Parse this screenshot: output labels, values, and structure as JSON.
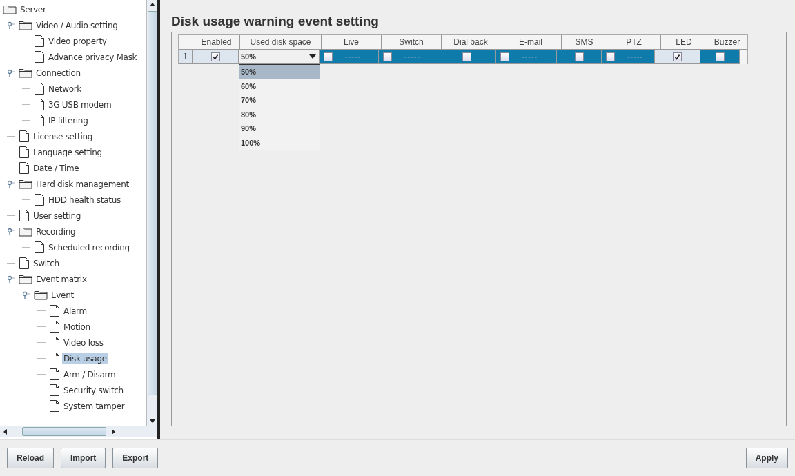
{
  "tree": [
    {
      "label": "Server",
      "selected": false,
      "children": [
        {
          "label": "Video / Audio setting",
          "expanded": true,
          "selected": false,
          "children": [
            {
              "label": "Video property",
              "selected": false
            },
            {
              "label": "Advance privacy Mask",
              "selected": false
            }
          ]
        },
        {
          "label": "Connection",
          "expanded": true,
          "selected": false,
          "children": [
            {
              "label": "Network",
              "selected": false
            },
            {
              "label": "3G USB modem",
              "selected": false
            },
            {
              "label": "IP filtering",
              "selected": false
            }
          ]
        },
        {
          "label": "License setting",
          "selected": false
        },
        {
          "label": "Language setting",
          "selected": false
        },
        {
          "label": "Date / Time",
          "selected": false
        },
        {
          "label": "Hard disk management",
          "expanded": true,
          "selected": false,
          "children": [
            {
              "label": "HDD health status",
              "selected": false
            }
          ]
        },
        {
          "label": "User setting",
          "selected": false
        },
        {
          "label": "Recording",
          "expanded": true,
          "selected": false,
          "children": [
            {
              "label": "Scheduled recording",
              "selected": false
            }
          ]
        },
        {
          "label": "Switch",
          "selected": false
        },
        {
          "label": "Event matrix",
          "expanded": true,
          "selected": false,
          "children": [
            {
              "label": "Event",
              "expanded": true,
              "selected": false,
              "children": [
                {
                  "label": "Alarm",
                  "selected": false
                },
                {
                  "label": "Motion",
                  "selected": false
                },
                {
                  "label": "Video loss",
                  "selected": false
                },
                {
                  "label": "Disk usage",
                  "selected": true
                },
                {
                  "label": "Arm / Disarm",
                  "selected": false
                },
                {
                  "label": "Security switch",
                  "selected": false
                },
                {
                  "label": "System tamper",
                  "selected": false
                }
              ]
            }
          ]
        }
      ]
    }
  ],
  "title": "Disk usage warning event setting",
  "table": {
    "columns": [
      "Enabled",
      "Used disk space",
      "Live",
      "Switch",
      "Dial back",
      "E-mail",
      "SMS",
      "PTZ",
      "LED",
      "Buzzer"
    ],
    "rows": [
      {
        "number": "1",
        "cells": [
          {
            "kind": "checkbox",
            "checked": true,
            "selected": false
          },
          {
            "kind": "combo",
            "value": "50%"
          },
          {
            "kind": "checkbox_text",
            "checked": false,
            "text": "-----",
            "selected": true
          },
          {
            "kind": "checkbox_text",
            "checked": false,
            "text": "-----",
            "selected": true
          },
          {
            "kind": "checkbox",
            "checked": false,
            "selected": true
          },
          {
            "kind": "checkbox_text",
            "checked": false,
            "text": "-----",
            "selected": true
          },
          {
            "kind": "checkbox",
            "checked": false,
            "selected": true
          },
          {
            "kind": "checkbox_text",
            "checked": false,
            "text": "-----",
            "selected": true
          },
          {
            "kind": "checkbox",
            "checked": true,
            "selected": false
          },
          {
            "kind": "checkbox",
            "checked": false,
            "selected": true
          }
        ]
      }
    ]
  },
  "dropdown": {
    "options": [
      {
        "label": "50%",
        "selected": true
      },
      {
        "label": "60%",
        "selected": false
      },
      {
        "label": "70%",
        "selected": false
      },
      {
        "label": "80%",
        "selected": false
      },
      {
        "label": "90%",
        "selected": false
      },
      {
        "label": "100%",
        "selected": false
      }
    ]
  },
  "buttons_left": [
    "Reload",
    "Import",
    "Export"
  ],
  "buttons_right": [
    "Apply"
  ]
}
